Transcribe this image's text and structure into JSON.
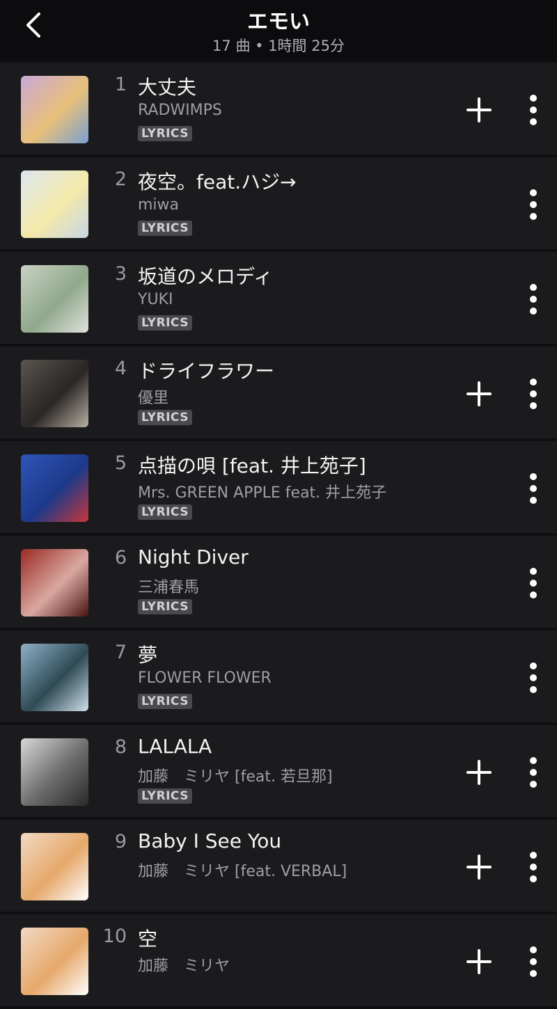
{
  "header": {
    "title": "エモい",
    "subtitle": "17 曲 • 1時間 25分",
    "back_icon": "chevron-left-icon"
  },
  "icons": {
    "add": "plus-icon",
    "more": "more-vertical-icon"
  },
  "tracks": [
    {
      "number": "1",
      "title": "大丈夫",
      "artist": "RADWIMPS",
      "badge": "LYRICS",
      "has_add": true,
      "art_colors": [
        "#c9a8d6",
        "#e8c07a",
        "#7a9fd0"
      ]
    },
    {
      "number": "2",
      "title": "夜空。feat.ハジ→",
      "artist": "miwa",
      "badge": "LYRICS",
      "has_add": false,
      "art_colors": [
        "#dde6f0",
        "#f4e9a8",
        "#c8d6e8"
      ]
    },
    {
      "number": "3",
      "title": "坂道のメロディ",
      "artist": "YUKI",
      "badge": "LYRICS",
      "has_add": false,
      "art_colors": [
        "#c9d2c4",
        "#8fa88a",
        "#e0e0dc"
      ]
    },
    {
      "number": "4",
      "title": "ドライフラワー",
      "artist": "優里",
      "badge": "LYRICS",
      "has_add": true,
      "art_colors": [
        "#5a5550",
        "#2a2624",
        "#b8b0a5"
      ]
    },
    {
      "number": "5",
      "title": "点描の唄 [feat. 井上苑子]",
      "artist": "Mrs. GREEN APPLE feat. 井上苑子",
      "badge": "LYRICS",
      "has_add": false,
      "art_colors": [
        "#2f55b8",
        "#1d3a8a",
        "#c8373a"
      ]
    },
    {
      "number": "6",
      "title": "Night Diver",
      "artist": "三浦春馬",
      "badge": "LYRICS",
      "has_add": false,
      "art_colors": [
        "#9a2a24",
        "#d9a8a0",
        "#4a1410"
      ]
    },
    {
      "number": "7",
      "title": "夢",
      "artist": "FLOWER FLOWER",
      "badge": "LYRICS",
      "has_add": false,
      "art_colors": [
        "#8fb0c8",
        "#2e4a55",
        "#cfe0ea"
      ]
    },
    {
      "number": "8",
      "title": "LALALA",
      "artist": "加藤　ミリヤ [feat. 若旦那]",
      "badge": "LYRICS",
      "has_add": true,
      "art_colors": [
        "#d8d8d8",
        "#6a6a6a",
        "#2a2a2a"
      ]
    },
    {
      "number": "9",
      "title": "Baby I See You",
      "artist": "加藤　ミリヤ [feat. VERBAL]",
      "badge": "",
      "has_add": true,
      "art_colors": [
        "#f2d9c4",
        "#e6a86a",
        "#ffffff"
      ]
    },
    {
      "number": "10",
      "title": "空",
      "artist": "加藤　ミリヤ",
      "badge": "",
      "has_add": true,
      "art_colors": [
        "#f2d9c4",
        "#e6a86a",
        "#ffffff"
      ]
    }
  ]
}
